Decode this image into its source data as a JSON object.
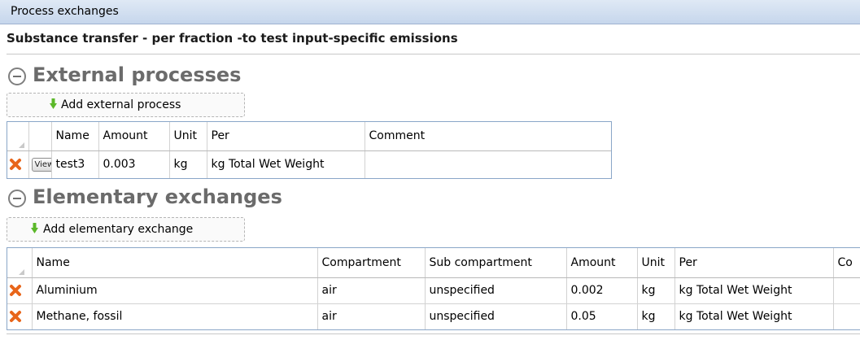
{
  "window": {
    "title": "Process exchanges"
  },
  "process": {
    "name": "Substance transfer - per fraction -to test input-specific emissions"
  },
  "external": {
    "section_title": "External processes",
    "add_label": "Add external process",
    "columns": [
      "",
      "",
      "Name",
      "Amount",
      "Unit",
      "Per",
      "Comment"
    ],
    "rows": [
      {
        "view_label": "View",
        "name": "test3",
        "amount": "0.003",
        "unit": "kg",
        "per": "kg Total Wet Weight",
        "comment": ""
      }
    ]
  },
  "elementary": {
    "section_title": "Elementary exchanges",
    "add_label": "Add elementary exchange",
    "columns": [
      "",
      "Name",
      "Compartment",
      "Sub compartment",
      "Amount",
      "Unit",
      "Per",
      "Co"
    ],
    "rows": [
      {
        "name": "Aluminium",
        "compartment": "air",
        "sub_compartment": "unspecified",
        "amount": "0.002",
        "unit": "kg",
        "per": "kg Total Wet Weight",
        "comment": ""
      },
      {
        "name": "Methane, fossil",
        "compartment": "air",
        "sub_compartment": "unspecified",
        "amount": "0.05",
        "unit": "kg",
        "per": "kg Total Wet Weight",
        "comment": ""
      }
    ]
  },
  "colors": {
    "delete_icon": "#e8651a",
    "add_arrow": "#5cb82a",
    "section_title": "#6b6b6b",
    "grid_border": "#8aa6c8"
  }
}
